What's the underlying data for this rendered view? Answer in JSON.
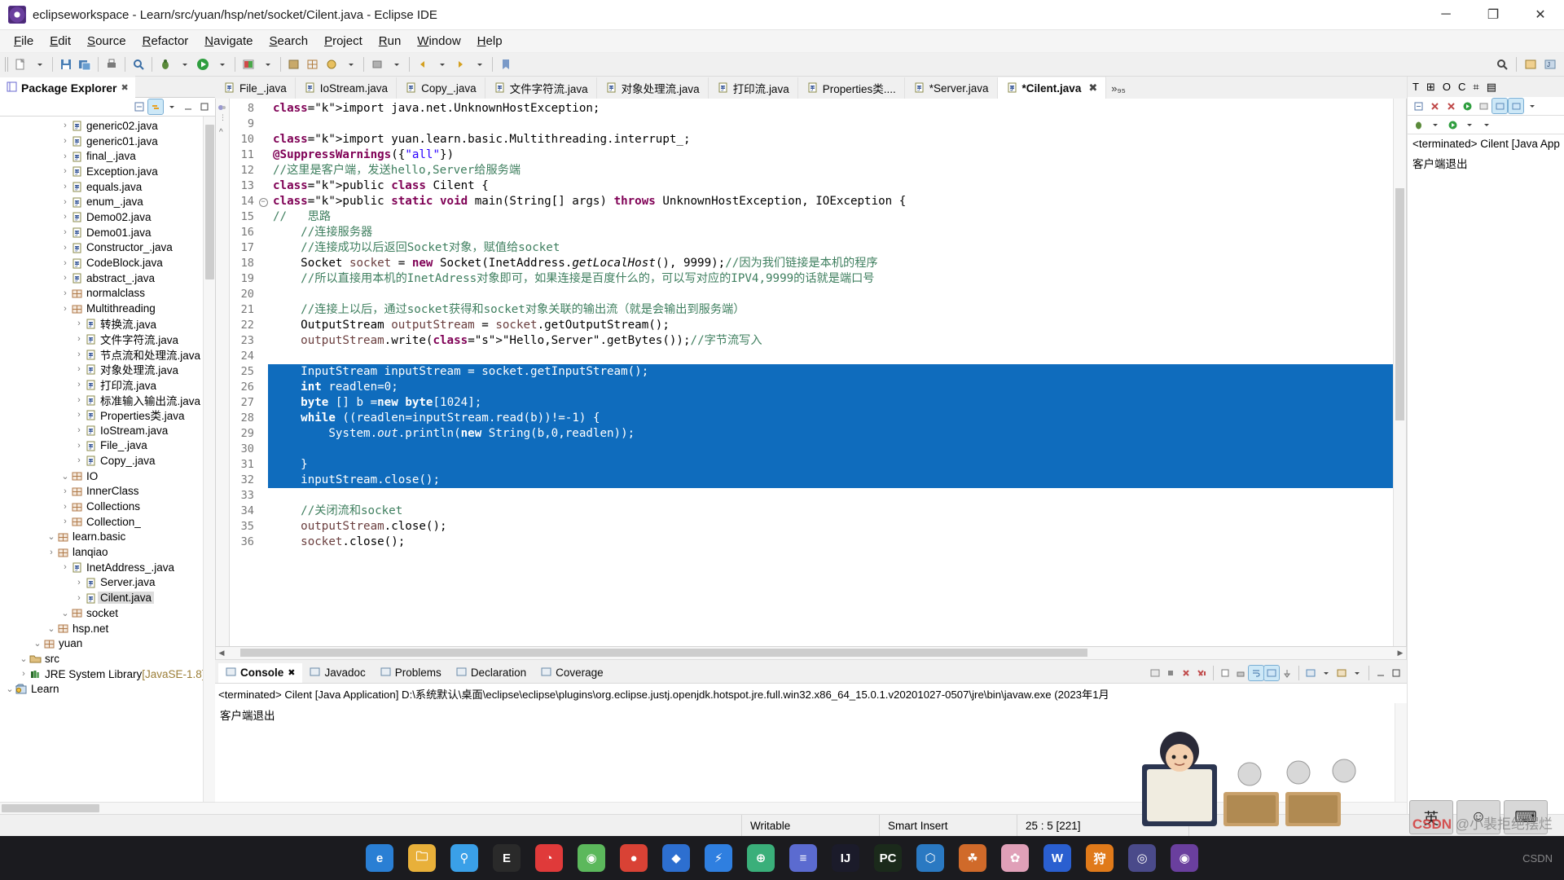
{
  "window": {
    "title": "eclipseworkspace - Learn/src/yuan/hsp/net/socket/Cilent.java - Eclipse IDE",
    "minimize": "─",
    "maximize": "❐",
    "close": "✕"
  },
  "menu": {
    "items": [
      "File",
      "Edit",
      "Source",
      "Refactor",
      "Navigate",
      "Search",
      "Project",
      "Run",
      "Window",
      "Help"
    ]
  },
  "package_explorer": {
    "tab_label": "Package Explorer",
    "tab_close": "✖",
    "collapse_all_icon": "collapse-all-icon",
    "link_editor_icon": "link-with-editor-icon",
    "tree": [
      {
        "indent": 0,
        "arrow": "⌄",
        "icon": "project",
        "label": "Learn",
        "suffix": "",
        "selected": false
      },
      {
        "indent": 1,
        "arrow": "›",
        "icon": "library",
        "label": "JRE System Library",
        "suffix": " [JavaSE-1.8]",
        "selected": false
      },
      {
        "indent": 1,
        "arrow": "⌄",
        "icon": "srcfolder",
        "label": "src",
        "suffix": "",
        "selected": false
      },
      {
        "indent": 2,
        "arrow": "⌄",
        "icon": "package",
        "label": "yuan",
        "suffix": "",
        "selected": false
      },
      {
        "indent": 3,
        "arrow": "⌄",
        "icon": "package",
        "label": "hsp.net",
        "suffix": "",
        "selected": false
      },
      {
        "indent": 4,
        "arrow": "⌄",
        "icon": "package",
        "label": "socket",
        "suffix": "",
        "selected": false
      },
      {
        "indent": 5,
        "arrow": "›",
        "icon": "java",
        "label": "Cilent.java",
        "suffix": "",
        "selected": true
      },
      {
        "indent": 5,
        "arrow": "›",
        "icon": "java",
        "label": "Server.java",
        "suffix": "",
        "selected": false
      },
      {
        "indent": 4,
        "arrow": "›",
        "icon": "java",
        "label": "InetAddress_.java",
        "suffix": "",
        "selected": false
      },
      {
        "indent": 3,
        "arrow": "›",
        "icon": "package",
        "label": "lanqiao",
        "suffix": "",
        "selected": false
      },
      {
        "indent": 3,
        "arrow": "⌄",
        "icon": "package",
        "label": "learn.basic",
        "suffix": "",
        "selected": false
      },
      {
        "indent": 4,
        "arrow": "›",
        "icon": "package",
        "label": "Collection_",
        "suffix": "",
        "selected": false
      },
      {
        "indent": 4,
        "arrow": "›",
        "icon": "package",
        "label": "Collections",
        "suffix": "",
        "selected": false
      },
      {
        "indent": 4,
        "arrow": "›",
        "icon": "package",
        "label": "InnerClass",
        "suffix": "",
        "selected": false
      },
      {
        "indent": 4,
        "arrow": "⌄",
        "icon": "package",
        "label": "IO",
        "suffix": "",
        "selected": false
      },
      {
        "indent": 5,
        "arrow": "›",
        "icon": "java",
        "label": "Copy_.java",
        "suffix": "",
        "selected": false
      },
      {
        "indent": 5,
        "arrow": "›",
        "icon": "java",
        "label": "File_.java",
        "suffix": "",
        "selected": false
      },
      {
        "indent": 5,
        "arrow": "›",
        "icon": "java",
        "label": "IoStream.java",
        "suffix": "",
        "selected": false
      },
      {
        "indent": 5,
        "arrow": "›",
        "icon": "java",
        "label": "Properties类.java",
        "suffix": "",
        "selected": false
      },
      {
        "indent": 5,
        "arrow": "›",
        "icon": "java",
        "label": "标准输入输出流.java",
        "suffix": "",
        "selected": false
      },
      {
        "indent": 5,
        "arrow": "›",
        "icon": "java",
        "label": "打印流.java",
        "suffix": "",
        "selected": false
      },
      {
        "indent": 5,
        "arrow": "›",
        "icon": "java",
        "label": "对象处理流.java",
        "suffix": "",
        "selected": false
      },
      {
        "indent": 5,
        "arrow": "›",
        "icon": "java",
        "label": "节点流和处理流.java",
        "suffix": "",
        "selected": false
      },
      {
        "indent": 5,
        "arrow": "›",
        "icon": "java",
        "label": "文件字符流.java",
        "suffix": "",
        "selected": false
      },
      {
        "indent": 5,
        "arrow": "›",
        "icon": "java",
        "label": "转换流.java",
        "suffix": "",
        "selected": false
      },
      {
        "indent": 4,
        "arrow": "›",
        "icon": "package",
        "label": "Multithreading",
        "suffix": "",
        "selected": false
      },
      {
        "indent": 4,
        "arrow": "›",
        "icon": "package",
        "label": "normalclass",
        "suffix": "",
        "selected": false
      },
      {
        "indent": 4,
        "arrow": "›",
        "icon": "java",
        "label": "abstract_.java",
        "suffix": "",
        "selected": false
      },
      {
        "indent": 4,
        "arrow": "›",
        "icon": "java",
        "label": "CodeBlock.java",
        "suffix": "",
        "selected": false
      },
      {
        "indent": 4,
        "arrow": "›",
        "icon": "java",
        "label": "Constructor_.java",
        "suffix": "",
        "selected": false
      },
      {
        "indent": 4,
        "arrow": "›",
        "icon": "java",
        "label": "Demo01.java",
        "suffix": "",
        "selected": false
      },
      {
        "indent": 4,
        "arrow": "›",
        "icon": "java",
        "label": "Demo02.java",
        "suffix": "",
        "selected": false
      },
      {
        "indent": 4,
        "arrow": "›",
        "icon": "java",
        "label": "enum_.java",
        "suffix": "",
        "selected": false
      },
      {
        "indent": 4,
        "arrow": "›",
        "icon": "java",
        "label": "equals.java",
        "suffix": "",
        "selected": false
      },
      {
        "indent": 4,
        "arrow": "›",
        "icon": "java",
        "label": "Exception.java",
        "suffix": "",
        "selected": false
      },
      {
        "indent": 4,
        "arrow": "›",
        "icon": "java",
        "label": "final_.java",
        "suffix": "",
        "selected": false
      },
      {
        "indent": 4,
        "arrow": "›",
        "icon": "java",
        "label": "generic01.java",
        "suffix": "",
        "selected": false
      },
      {
        "indent": 4,
        "arrow": "›",
        "icon": "java",
        "label": "generic02.java",
        "suffix": "",
        "selected": false
      }
    ]
  },
  "editor": {
    "tabs": [
      {
        "label": "File_.java",
        "active": false,
        "dirty": false
      },
      {
        "label": "IoStream.java",
        "active": false,
        "dirty": false
      },
      {
        "label": "Copy_.java",
        "active": false,
        "dirty": false
      },
      {
        "label": "文件字符流.java",
        "active": false,
        "dirty": false
      },
      {
        "label": "对象处理流.java",
        "active": false,
        "dirty": false
      },
      {
        "label": "打印流.java",
        "active": false,
        "dirty": false
      },
      {
        "label": "Properties类....",
        "active": false,
        "dirty": false
      },
      {
        "label": "*Server.java",
        "active": false,
        "dirty": true
      },
      {
        "label": "*Cilent.java",
        "active": true,
        "dirty": true
      }
    ],
    "overflow_label": "»₉₅",
    "first_line_number": 8,
    "lines": [
      {
        "n": 8,
        "text": "import java.net.UnknownHostException;",
        "highlight": false
      },
      {
        "n": 9,
        "text": "",
        "highlight": false
      },
      {
        "n": 10,
        "text": "import yuan.learn.basic.Multithreading.interrupt_;",
        "highlight": false
      },
      {
        "n": 11,
        "text": "@SuppressWarnings({\"all\"})",
        "highlight": false
      },
      {
        "n": 12,
        "text": "//这里是客户端，发送hello,Server给服务端",
        "highlight": false
      },
      {
        "n": 13,
        "text": "public class Cilent {",
        "highlight": false
      },
      {
        "n": 14,
        "text": "public static void main(String[] args) throws UnknownHostException, IOException {",
        "highlight": false
      },
      {
        "n": 15,
        "text": "//   思路",
        "highlight": false
      },
      {
        "n": 16,
        "text": "    //连接服务器",
        "highlight": false
      },
      {
        "n": 17,
        "text": "    //连接成功以后返回Socket对象，赋值给socket",
        "highlight": false
      },
      {
        "n": 18,
        "text": "    Socket socket = new Socket(InetAddress.getLocalHost(), 9999);//因为我们链接是本机的程序",
        "highlight": false
      },
      {
        "n": 19,
        "text": "    //所以直接用本机的InetAdress对象即可，如果连接是百度什么的，可以写对应的IPV4,9999的话就是端口号",
        "highlight": false
      },
      {
        "n": 20,
        "text": "",
        "highlight": false
      },
      {
        "n": 21,
        "text": "    //连接上以后，通过socket获得和socket对象关联的输出流（就是会输出到服务端）",
        "highlight": false
      },
      {
        "n": 22,
        "text": "    OutputStream outputStream = socket.getOutputStream();",
        "highlight": false
      },
      {
        "n": 23,
        "text": "    outputStream.write(\"Hello,Server\".getBytes());//字节流写入",
        "highlight": false
      },
      {
        "n": 24,
        "text": "",
        "highlight": false
      },
      {
        "n": 25,
        "text": "    InputStream inputStream = socket.getInputStream();",
        "highlight": true
      },
      {
        "n": 26,
        "text": "    int readlen=0;",
        "highlight": true
      },
      {
        "n": 27,
        "text": "    byte [] b =new byte[1024];",
        "highlight": true
      },
      {
        "n": 28,
        "text": "    while ((readlen=inputStream.read(b))!=-1) {",
        "highlight": true
      },
      {
        "n": 29,
        "text": "        System.out.println(new String(b,0,readlen));",
        "highlight": true
      },
      {
        "n": 30,
        "text": "",
        "highlight": true
      },
      {
        "n": 31,
        "text": "    }",
        "highlight": true
      },
      {
        "n": 32,
        "text": "    inputStream.close();",
        "highlight": true
      },
      {
        "n": 33,
        "text": "",
        "highlight": false
      },
      {
        "n": 34,
        "text": "    //关闭流和socket",
        "highlight": false
      },
      {
        "n": 35,
        "text": "    outputStream.close();",
        "highlight": false
      },
      {
        "n": 36,
        "text": "    socket.close();",
        "highlight": false
      }
    ]
  },
  "console": {
    "tabs": [
      {
        "label": "Console",
        "icon": "console-icon",
        "active": true,
        "close": "✖"
      },
      {
        "label": "Javadoc",
        "icon": "javadoc-icon",
        "active": false
      },
      {
        "label": "Problems",
        "icon": "problems-icon",
        "active": false
      },
      {
        "label": "Declaration",
        "icon": "declaration-icon",
        "active": false
      },
      {
        "label": "Coverage",
        "icon": "coverage-icon",
        "active": false
      }
    ],
    "header": "<terminated> Cilent [Java Application] D:\\系统默认\\桌面\\eclipse\\eclipse\\plugins\\org.eclipse.justj.openjdk.hotspot.jre.full.win32.x86_64_15.0.1.v20201027-0507\\jre\\bin\\javaw.exe  (2023年1月",
    "output": "客户端退出"
  },
  "right_panel": {
    "tabs": [
      "T",
      "⊞",
      "O",
      "C",
      "⌗",
      "▤"
    ],
    "launch_label": "<terminated> Cilent [Java App",
    "output": "客户端退出"
  },
  "status": {
    "writable": "Writable",
    "insert_mode": "Smart Insert",
    "position": "25 : 5 [221]"
  },
  "taskbar": {
    "icons": [
      {
        "name": "edge-icon",
        "glyph": "e",
        "color": "#2a7fd4"
      },
      {
        "name": "folder-explorer-icon",
        "glyph": "🗀",
        "color": "#e8b03a"
      },
      {
        "name": "search-icon",
        "glyph": "⚲",
        "color": "#3aa0e8"
      },
      {
        "name": "epic-games-icon",
        "glyph": "E",
        "color": "#2a2a2a"
      },
      {
        "name": "clock-app-icon",
        "glyph": "◔",
        "color": "#e03a3a"
      },
      {
        "name": "green-app-icon",
        "glyph": "◉",
        "color": "#5cb85c"
      },
      {
        "name": "chrome-icon",
        "glyph": "●",
        "color": "#d94235"
      },
      {
        "name": "blue-app-icon",
        "glyph": "◆",
        "color": "#2d6fd0"
      },
      {
        "name": "lightning-icon",
        "glyph": "⚡",
        "color": "#2f7fe0"
      },
      {
        "name": "globe-icon",
        "glyph": "⊕",
        "color": "#3aaf7a"
      },
      {
        "name": "stack-icon",
        "glyph": "≡",
        "color": "#5b6bd0"
      },
      {
        "name": "intellij-icon",
        "glyph": "IJ",
        "color": "#1b1b2a"
      },
      {
        "name": "pycharm-icon",
        "glyph": "PC",
        "color": "#1b2a1b"
      },
      {
        "name": "vscode-icon",
        "glyph": "⬡",
        "color": "#2a79c2"
      },
      {
        "name": "crab-app-icon",
        "glyph": "☘",
        "color": "#d06a2a"
      },
      {
        "name": "anime-app-icon",
        "glyph": "✿",
        "color": "#e0a0b8"
      },
      {
        "name": "wegame-icon",
        "glyph": "W",
        "color": "#2a5fd0"
      },
      {
        "name": "huya-icon",
        "glyph": "狩",
        "color": "#e07a1a"
      },
      {
        "name": "record-app-icon",
        "glyph": "◎",
        "color": "#4a4a8a"
      },
      {
        "name": "eclipse-icon",
        "glyph": "◉",
        "color": "#6a3f9e"
      }
    ]
  },
  "ime": {
    "lang": "英",
    "keys": [
      "英",
      "☺",
      "⌨"
    ]
  },
  "watermark": {
    "csdn": "CSDN",
    "author": "@小裴拒绝摆烂"
  },
  "colors": {
    "selection_blue": "#0f6cbd",
    "keyword": "#7f0055",
    "string": "#2a00ff",
    "comment": "#3f7f5f",
    "field": "#6a3e3e"
  }
}
